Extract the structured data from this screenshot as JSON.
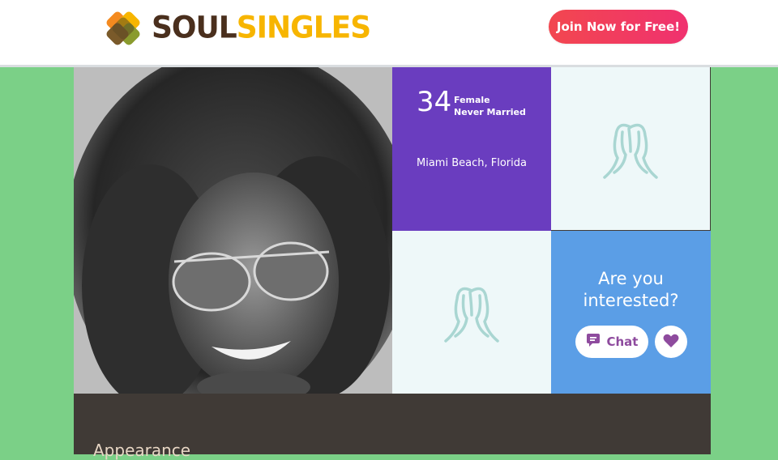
{
  "header": {
    "logo_text_part1": "SOUL",
    "logo_text_part2": "SINGLES",
    "join_label": "Join Now for Free!"
  },
  "profile": {
    "age": "34",
    "gender": "Female",
    "marital_status": "Never Married",
    "location": "Miami Beach, Florida",
    "interest_line1": "Are you",
    "interest_line2": "interested?",
    "chat_label": "Chat",
    "section_title": "Appearance"
  },
  "icons": {
    "logo": "soulsingles-logo-mark",
    "silhouette": "person-silhouette-icon",
    "chat": "chat-bubble-icon",
    "like": "heart-icon"
  },
  "colors": {
    "page_background": "#7bd087",
    "info_tile": "#6a3dbf",
    "interest_tile": "#5b9ee6",
    "placeholder_tile": "#eef8f9",
    "join_button": "#f2474f",
    "accent_purple": "#8e4b9e",
    "logo_brown": "#4a2f1d",
    "logo_yellow": "#f7b500"
  }
}
